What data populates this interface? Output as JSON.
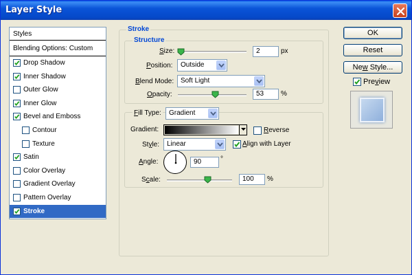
{
  "window": {
    "title": "Layer Style"
  },
  "sidebar": {
    "header": "Styles",
    "blending": "Blending Options: Custom",
    "items": [
      {
        "label": "Drop Shadow",
        "checked": true
      },
      {
        "label": "Inner Shadow",
        "checked": true
      },
      {
        "label": "Outer Glow",
        "checked": false
      },
      {
        "label": "Inner Glow",
        "checked": true
      },
      {
        "label": "Bevel and Emboss",
        "checked": true
      },
      {
        "label": "Contour",
        "checked": false
      },
      {
        "label": "Texture",
        "checked": false
      },
      {
        "label": "Satin",
        "checked": true
      },
      {
        "label": "Color Overlay",
        "checked": false
      },
      {
        "label": "Gradient Overlay",
        "checked": false
      },
      {
        "label": "Pattern Overlay",
        "checked": false
      },
      {
        "label": "Stroke",
        "checked": true,
        "selected": true
      }
    ]
  },
  "stroke": {
    "title": "Stroke",
    "structure_title": "Structure",
    "size": {
      "label": "Size:",
      "value": "2",
      "unit": "px"
    },
    "position": {
      "label": "Position:",
      "value": "Outside"
    },
    "blend_mode": {
      "label": "Blend Mode:",
      "value": "Soft Light"
    },
    "opacity": {
      "label": "Opacity:",
      "value": "53",
      "unit": "%"
    }
  },
  "fill": {
    "fill_type_label": "Fill Type:",
    "fill_type_value": "Gradient",
    "gradient_label": "Gradient:",
    "reverse_label": "Reverse",
    "reverse_checked": false,
    "style_label": "Style:",
    "style_value": "Linear",
    "align_label": "Align with Layer",
    "align_checked": true,
    "angle_label": "Angle:",
    "angle_value": "90",
    "angle_unit": "°",
    "scale_label": "Scale:",
    "scale_value": "100",
    "scale_unit": "%"
  },
  "buttons": {
    "ok": "OK",
    "reset": "Reset",
    "new_style": "New Style...",
    "preview_label": "Preview",
    "preview_checked": true
  },
  "colors": {
    "title_bar": "#0a54d8",
    "selection": "#316ac5",
    "group_title": "#0046d5",
    "close_button": "#c8421d"
  },
  "icons": {
    "close": "close-icon",
    "checkbox_check": "checkmark-icon",
    "dropdown": "chevron-down-icon",
    "slider": "slider-thumb-icon",
    "angle": "angle-dial-icon"
  }
}
